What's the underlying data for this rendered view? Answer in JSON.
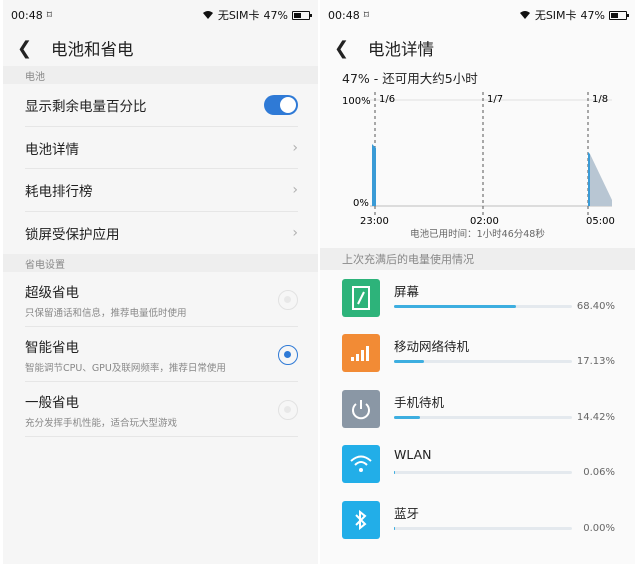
{
  "left": {
    "status": {
      "time": "00:48",
      "sim": "无SIM卡",
      "battery": "47%"
    },
    "title": "电池和省电",
    "section_battery": "电池",
    "items": [
      {
        "label": "显示剩余电量百分比"
      },
      {
        "label": "电池详情"
      },
      {
        "label": "耗电排行榜"
      },
      {
        "label": "锁屏受保护应用"
      }
    ],
    "section_power": "省电设置",
    "modes": [
      {
        "title": "超级省电",
        "desc": "只保留通话和信息，推荐电量低时使用",
        "selected": false
      },
      {
        "title": "智能省电",
        "desc": "智能调节CPU、GPU及联网频率，推荐日常使用",
        "selected": true
      },
      {
        "title": "一般省电",
        "desc": "充分发挥手机性能，适合玩大型游戏",
        "selected": false
      }
    ]
  },
  "right": {
    "status": {
      "time": "00:48",
      "sim": "无SIM卡",
      "battery": "47%"
    },
    "title": "电池详情",
    "summary": "47% - 还可用大约5小时",
    "chart_data": {
      "type": "area",
      "y_tick_labels": [
        "100%",
        "0%"
      ],
      "x_tick_labels": [
        "23:00",
        "02:00",
        "05:00"
      ],
      "date_markers": [
        "1/6",
        "1/7",
        "1/8"
      ],
      "used_time": "电池已用时间：1小时46分48秒"
    },
    "usage_header": "上次充满后的电量使用情况",
    "apps": [
      {
        "name": "屏幕",
        "percent": "68.40%",
        "value": 68.4,
        "color": "#2db37a"
      },
      {
        "name": "移动网络待机",
        "percent": "17.13%",
        "value": 17.13,
        "color": "#f28b35"
      },
      {
        "name": "手机待机",
        "percent": "14.42%",
        "value": 14.42,
        "color": "#8a97a5"
      },
      {
        "name": "WLAN",
        "percent": "0.06%",
        "value": 0.06,
        "color": "#22aee8"
      },
      {
        "name": "蓝牙",
        "percent": "0.00%",
        "value": 0.0,
        "color": "#22aee8"
      }
    ]
  }
}
